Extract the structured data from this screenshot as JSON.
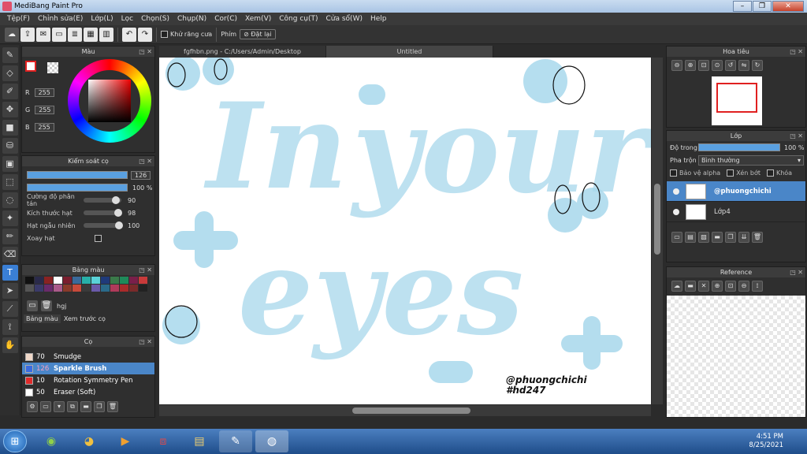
{
  "window": {
    "title": "MediBang Paint Pro"
  },
  "menu": [
    "Tệp(F)",
    "Chỉnh sửa(E)",
    "Lớp(L)",
    "Lọc",
    "Chọn(S)",
    "Chụp(N)",
    "Cor(C)",
    "Xem(V)",
    "Công cụ(T)",
    "Cửa sổ(W)",
    "Help"
  ],
  "toolbar": {
    "antialias_label": "Khử răng cưa",
    "key_label": "Phím",
    "reset_label": "Đặt lại"
  },
  "color_panel": {
    "title": "Màu",
    "r_label": "R",
    "g_label": "G",
    "b_label": "B",
    "r": "255",
    "g": "255",
    "b": "255"
  },
  "brush_control": {
    "title": "Kiểm soát cọ",
    "size_value": "126",
    "opacity_value": "100 %",
    "params": [
      {
        "label": "Cường độ phân tán",
        "value": "90",
        "fill": 0.9
      },
      {
        "label": "Kích thước hạt",
        "value": "98",
        "fill": 0.98
      },
      {
        "label": "Hạt ngẫu nhiên",
        "value": "100",
        "fill": 1.0
      },
      {
        "label": "Xoay hạt",
        "value": "",
        "fill": 0
      }
    ]
  },
  "palette": {
    "title": "Bảng màu",
    "name": "hgj",
    "tab1": "Bảng màu",
    "tab2": "Xem trước cọ",
    "colors": [
      "#111111",
      "#2a2a4a",
      "#8a2222",
      "#ffffff",
      "#7a1e2e",
      "#3a6a9a",
      "#27b0a8",
      "#5ad2d8",
      "#1f3a7a",
      "#3a7a4a",
      "#1f8a5a",
      "#7a1f4a",
      "#c83a3a",
      "#555555",
      "#3a3a6a",
      "#6a2a6a",
      "#aa5a8a",
      "#8a3a2a",
      "#c84a3a",
      "#3a3a3a",
      "#6a5aaa",
      "#2a6a8a",
      "#b03a5a",
      "#aa2a2a",
      "#7a2a2a",
      "#222222"
    ]
  },
  "brush_panel": {
    "title": "Cọ",
    "brushes": [
      {
        "size": "70",
        "name": "Smudge",
        "color": "#f0d8c8",
        "selected": false
      },
      {
        "size": "126",
        "name": "Sparkle Brush",
        "color": "#3a6adf",
        "selected": true
      },
      {
        "size": "10",
        "name": "Rotation Symmetry Pen",
        "color": "#e02a2a",
        "selected": false
      },
      {
        "size": "50",
        "name": "Eraser (Soft)",
        "color": "#ffffff",
        "selected": false
      }
    ]
  },
  "tabs": [
    {
      "label": "fgfhbn.png - C:/Users/Admin/Desktop"
    },
    {
      "label": "Untitled"
    }
  ],
  "canvas": {
    "watermark_line1": "@phuongchichi",
    "watermark_line2": "#hd247",
    "text_color": "#a8d8ec"
  },
  "navigator": {
    "title": "Hoa tiêu"
  },
  "layers": {
    "title": "Lớp",
    "opacity_label": "Độ trong",
    "opacity_value": "100 %",
    "blend_label": "Pha trộn",
    "blend_value": "Bình thường",
    "protect_alpha": "Bảo vệ alpha",
    "clipping": "Xén bớt",
    "lock": "Khóa",
    "items": [
      {
        "name": "@phuongchichi",
        "selected": true
      },
      {
        "name": "Lớp4",
        "selected": false
      }
    ]
  },
  "reference": {
    "title": "Reference"
  },
  "taskbar": {
    "time": "4:51 PM",
    "date": "8/25/2021"
  }
}
